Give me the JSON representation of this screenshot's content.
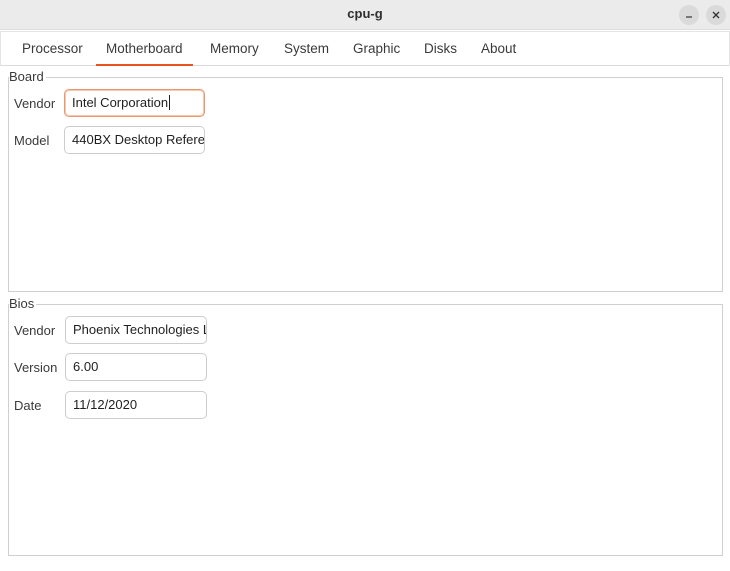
{
  "window": {
    "title": "cpu-g"
  },
  "tabs": [
    {
      "label": "Processor"
    },
    {
      "label": "Motherboard",
      "active": true
    },
    {
      "label": "Memory"
    },
    {
      "label": "System"
    },
    {
      "label": "Graphic"
    },
    {
      "label": "Disks"
    },
    {
      "label": "About"
    }
  ],
  "board": {
    "title": "Board",
    "vendor_label": "Vendor",
    "vendor_value": "Intel Corporation",
    "model_label": "Model",
    "model_value": "440BX Desktop Refere"
  },
  "bios": {
    "title": "Bios",
    "vendor_label": "Vendor",
    "vendor_value": "Phoenix Technologies L",
    "version_label": "Version",
    "version_value": "6.00",
    "date_label": "Date",
    "date_value": "11/12/2020"
  },
  "colors": {
    "accent": "#e95420",
    "titlebar": "#ebebeb"
  },
  "icons": {
    "minimize": "minimize-icon",
    "close": "close-icon"
  }
}
